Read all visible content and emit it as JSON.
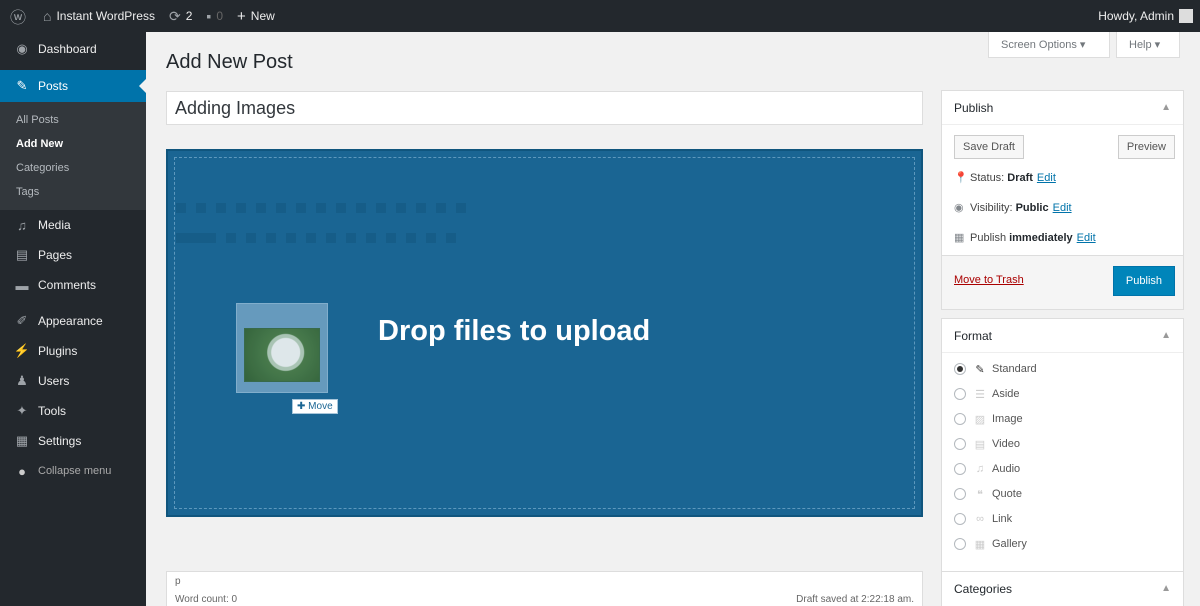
{
  "adminbar": {
    "site_name": "Instant WordPress",
    "updates_count": "2",
    "comments_count": "0",
    "new_label": "New",
    "howdy": "Howdy, Admin"
  },
  "sidebar": {
    "items": [
      {
        "label": "Dashboard",
        "icon": "dashboard-icon"
      },
      {
        "label": "Posts",
        "icon": "pin-icon"
      },
      {
        "label": "Media",
        "icon": "media-icon"
      },
      {
        "label": "Pages",
        "icon": "pages-icon"
      },
      {
        "label": "Comments",
        "icon": "comments-icon"
      },
      {
        "label": "Appearance",
        "icon": "brush-icon"
      },
      {
        "label": "Plugins",
        "icon": "plug-icon"
      },
      {
        "label": "Users",
        "icon": "users-icon"
      },
      {
        "label": "Tools",
        "icon": "wrench-icon"
      },
      {
        "label": "Settings",
        "icon": "settings-icon"
      },
      {
        "label": "Collapse menu",
        "icon": "collapse-icon"
      }
    ],
    "posts_submenu": [
      "All Posts",
      "Add New",
      "Categories",
      "Tags"
    ]
  },
  "header": {
    "screen_options": "Screen Options ▾",
    "help": "Help ▾",
    "page_title": "Add New Post"
  },
  "editor": {
    "title_value": "Adding Images",
    "drop_text": "Drop files to upload",
    "move_label": "Move",
    "path": "p",
    "word_count": "Word count: 0",
    "draft_saved": "Draft saved at 2:22:18 am."
  },
  "publish": {
    "heading": "Publish",
    "save_draft": "Save Draft",
    "preview": "Preview",
    "status_label": "Status:",
    "status_value": "Draft",
    "visibility_label": "Visibility:",
    "visibility_value": "Public",
    "publish_label": "Publish",
    "publish_value": "immediately",
    "edit": "Edit",
    "trash": "Move to Trash",
    "publish_button": "Publish"
  },
  "format": {
    "heading": "Format",
    "options": [
      "Standard",
      "Aside",
      "Image",
      "Video",
      "Audio",
      "Quote",
      "Link",
      "Gallery"
    ],
    "selected": "Standard"
  },
  "categories": {
    "heading": "Categories"
  },
  "colors": {
    "adminbar": "#23282d",
    "accent": "#0073aa",
    "drop_overlay": "#1a6593",
    "publish_button": "#0085ba",
    "trash": "#aa0000"
  }
}
